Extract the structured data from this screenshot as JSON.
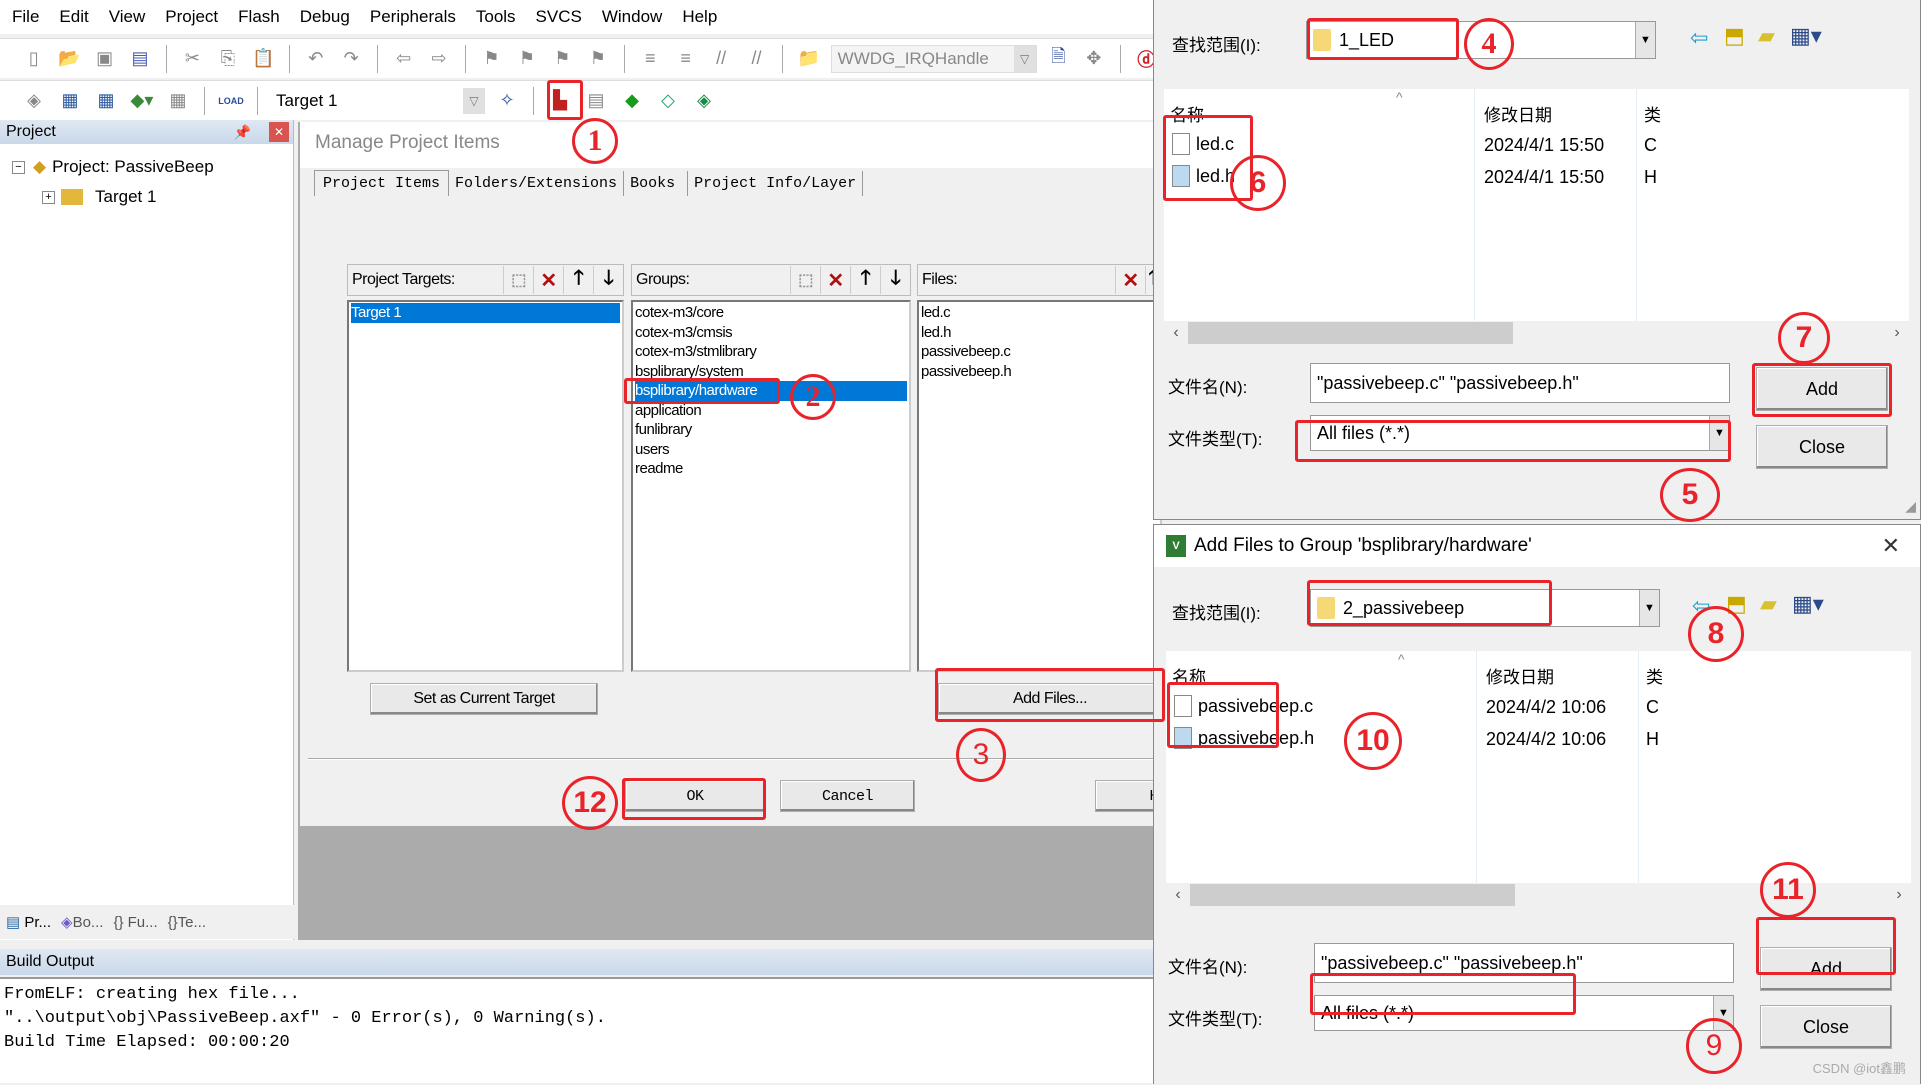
{
  "menu": [
    "File",
    "Edit",
    "View",
    "Project",
    "Flash",
    "Debug",
    "Peripherals",
    "Tools",
    "SVCS",
    "Window",
    "Help"
  ],
  "toolbar": {
    "function_combo": "WWDG_IRQHandle",
    "target_combo": "Target 1",
    "load_label": "LOAD"
  },
  "project_panel": {
    "title": "Project",
    "root": "Project: PassiveBeep",
    "child": "Target 1",
    "bottom_tabs": [
      "Pr...",
      "Bo...",
      "Fu...",
      "Te..."
    ]
  },
  "manage_dialog": {
    "title": "Manage Project Items",
    "tabs": [
      "Project Items",
      "Folders/Extensions",
      "Books",
      "Project Info/Layer"
    ],
    "targets_label": "Project Targets:",
    "groups_label": "Groups:",
    "files_label": "Files:",
    "targets": [
      "Target 1"
    ],
    "selected_target": 0,
    "groups": [
      "cotex-m3/core",
      "cotex-m3/cmsis",
      "cotex-m3/stmlibrary",
      "bsplibrary/system",
      "bsplibrary/hardware",
      "application",
      "funlibrary",
      "users",
      "readme"
    ],
    "selected_group": 4,
    "files": [
      "led.c",
      "led.h",
      "passivebeep.c",
      "passivebeep.h"
    ],
    "set_current_label": "Set as Current Target",
    "add_files_label": "Add Files...",
    "ok_label": "OK",
    "cancel_label": "Cancel",
    "help_label": "H"
  },
  "build_output": {
    "title": "Build Output",
    "lines": [
      "FromELF: creating hex file...",
      "\"..\\output\\obj\\PassiveBeep.axf\" - 0 Error(s), 0 Warning(s).",
      "Build Time Elapsed:  00:00:20"
    ]
  },
  "dialog1": {
    "lookin_label": "查找范围(I):",
    "lookin_value": "1_LED",
    "col_name": "名称",
    "col_date": "修改日期",
    "col_type": "类",
    "files": [
      {
        "name": "led.c",
        "date": "2024/4/1 15:50",
        "type": "C"
      },
      {
        "name": "led.h",
        "date": "2024/4/1 15:50",
        "type": "H"
      }
    ],
    "filename_label": "文件名(N):",
    "filename_value": "\"passivebeep.c\" \"passivebeep.h\"",
    "filetype_label": "文件类型(T):",
    "filetype_value": "All files (*.*)",
    "add_label": "Add",
    "close_label": "Close"
  },
  "dialog2": {
    "title": "Add Files to Group 'bsplibrary/hardware'",
    "lookin_label": "查找范围(I):",
    "lookin_value": "2_passivebeep",
    "col_name": "名称",
    "col_date": "修改日期",
    "col_type": "类",
    "files": [
      {
        "name": "passivebeep.c",
        "date": "2024/4/2 10:06",
        "type": "C"
      },
      {
        "name": "passivebeep.h",
        "date": "2024/4/2 10:06",
        "type": "H"
      }
    ],
    "filename_label": "文件名(N):",
    "filename_value": "\"passivebeep.c\" \"passivebeep.h\"",
    "filetype_label": "文件类型(T):",
    "filetype_value": "All files (*.*)",
    "add_label": "Add",
    "close_label": "Close"
  },
  "annotations": [
    "1",
    "2",
    "3",
    "4",
    "5",
    "6",
    "7",
    "8",
    "9",
    "10",
    "11",
    "12"
  ],
  "watermark": "CSDN @iot鑫鹏",
  "colors": {
    "highlight": "#e8232a",
    "selection": "#0078d7"
  }
}
